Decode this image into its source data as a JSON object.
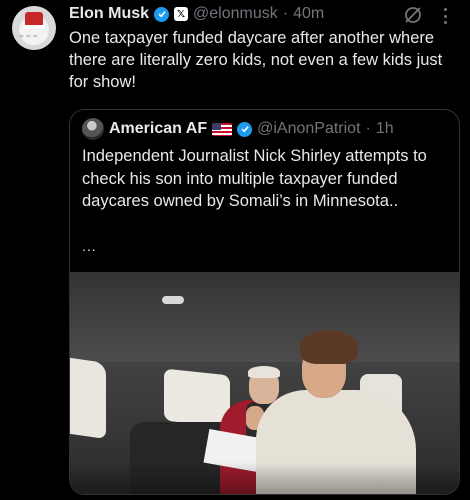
{
  "post": {
    "author": {
      "name": "Elon Musk",
      "handle": "@elonmusk",
      "separator": "·",
      "time": "40m"
    },
    "text": "One taxpayer funded daycare after another where there are literally zero kids, not even a few kids just for show!"
  },
  "quote": {
    "author": {
      "name": "American AF",
      "handle": "@iAnonPatriot",
      "separator": "·",
      "time": "1h"
    },
    "text": "Independent Journalist Nick Shirley attempts to check his son into multiple taxpayer funded daycares owned by Somali’s in Minnesota..",
    "ellipsis": "..."
  },
  "icons": {
    "verified": "verified-badge-icon",
    "x_affiliate": "x-logo-icon",
    "grok": "grok-icon",
    "more": "more-options-icon",
    "flag": "us-flag-emoji"
  },
  "colors": {
    "accent": "#1d9bf0",
    "background": "#000000",
    "muted": "#71767b",
    "text": "#e7e9ea"
  }
}
